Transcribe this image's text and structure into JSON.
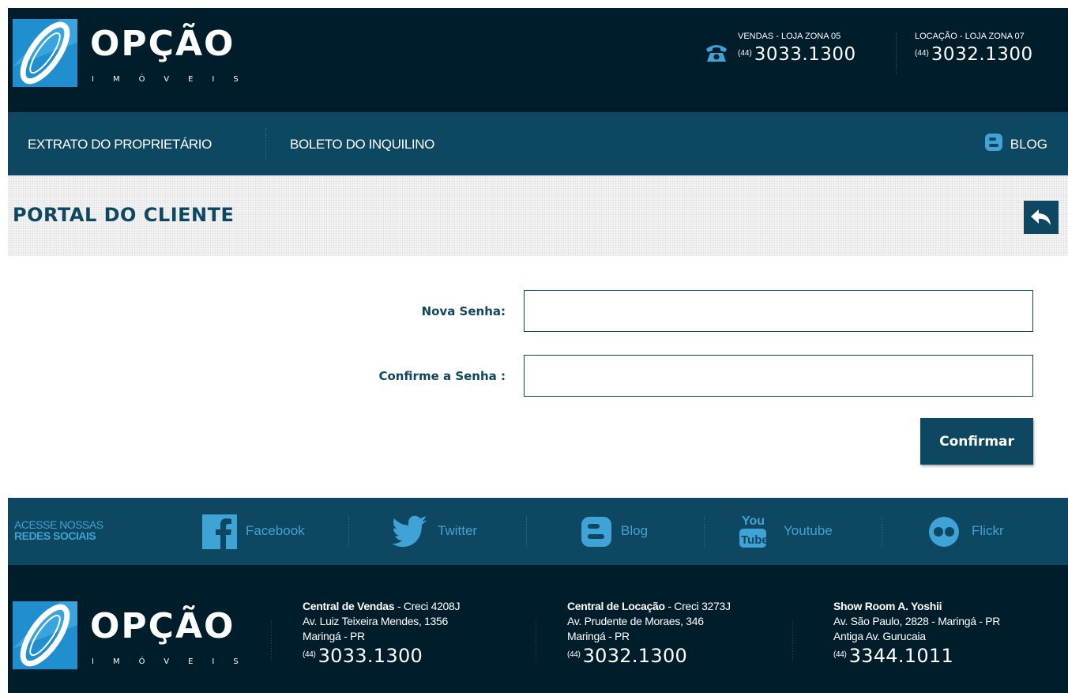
{
  "brand": {
    "name": "OPÇÃO",
    "tagline": "IMÓVEIS"
  },
  "header": {
    "contacts": [
      {
        "label": "VENDAS - LOJA ZONA 05",
        "ddd": "(44)",
        "number": "3033.1300"
      },
      {
        "label": "LOCAÇÃO - LOJA ZONA 07",
        "ddd": "(44)",
        "number": "3032.1300"
      }
    ]
  },
  "nav": {
    "items": [
      {
        "label": "EXTRATO DO PROPRIETÁRIO"
      },
      {
        "label": "BOLETO DO INQUILINO"
      }
    ],
    "blog_label": "BLOG"
  },
  "page": {
    "title": "PORTAL DO CLIENTE"
  },
  "form": {
    "new_password_label": "Nova Senha:",
    "new_password_value": "",
    "confirm_password_label": "Confirme a Senha :",
    "confirm_password_value": "",
    "submit_label": "Confirmar"
  },
  "social": {
    "caption_line1": "ACESSE NOSSAS",
    "caption_line2": "REDES SOCIAIS",
    "links": [
      {
        "label": "Facebook",
        "icon": "facebook-icon"
      },
      {
        "label": "Twitter",
        "icon": "twitter-icon"
      },
      {
        "label": "Blog",
        "icon": "blogger-icon"
      },
      {
        "label": "Youtube",
        "icon": "youtube-icon"
      },
      {
        "label": "Flickr",
        "icon": "flickr-icon"
      }
    ]
  },
  "footer": {
    "offices": [
      {
        "name": "Central de Vendas",
        "creci": " - Creci 4208J",
        "address1": "Av. Luiz Teixeira Mendes, 1356",
        "address2": "Maringá - PR",
        "ddd": "(44)",
        "number": "3033.1300"
      },
      {
        "name": "Central de Locação",
        "creci": " - Creci 3273J",
        "address1": "Av. Prudente de Moraes, 346",
        "address2": "Maringá - PR",
        "ddd": "(44)",
        "number": "3032.1300"
      },
      {
        "name": "Show Room A. Yoshii",
        "creci": "",
        "address1": "Av. São Paulo, 2828 - Maringá - PR",
        "address2": "Antiga Av. Gurucaia",
        "ddd": "(44)",
        "number": "3344.1011"
      }
    ]
  },
  "colors": {
    "dark_navy": "#001d2b",
    "brand_teal": "#0e4761",
    "link_blue": "#3fa3d6"
  }
}
